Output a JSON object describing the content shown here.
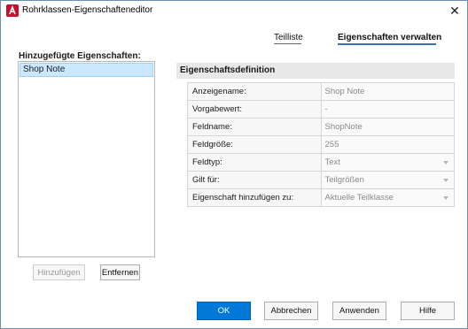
{
  "window": {
    "title": "Rohrklassen-Eigenschafteneditor",
    "close_symbol": "✕"
  },
  "tabs": [
    {
      "label": "Teilliste",
      "active": false
    },
    {
      "label": "Eigenschaften verwalten",
      "active": true
    }
  ],
  "added_properties": {
    "label": "Hinzugefügte Eigenschaften:",
    "items": [
      "Shop Note"
    ],
    "add_button": "Hinzufügen",
    "remove_button": "Entfernen"
  },
  "definition": {
    "header": "Eigenschaftsdefinition",
    "rows": [
      {
        "name": "Anzeigename:",
        "value": "Shop Note",
        "dropdown": false
      },
      {
        "name": "Vorgabewert:",
        "value": "-",
        "dropdown": false
      },
      {
        "name": "Feldname:",
        "value": "ShopNote",
        "dropdown": false
      },
      {
        "name": "Feldgröße:",
        "value": "255",
        "dropdown": false
      },
      {
        "name": "Feldtyp:",
        "value": "Text",
        "dropdown": true
      },
      {
        "name": "Gilt für:",
        "value": "Teilgrößen",
        "dropdown": true
      },
      {
        "name": "Eigenschaft hinzufügen zu:",
        "value": "Aktuelle Teilklasse",
        "dropdown": true
      }
    ]
  },
  "footer": {
    "ok": "OK",
    "cancel": "Abbrechen",
    "apply": "Anwenden",
    "help": "Hilfe"
  },
  "colors": {
    "accent": "#0078d7",
    "app_icon": "#c8102e",
    "selection": "#cce8ff"
  }
}
